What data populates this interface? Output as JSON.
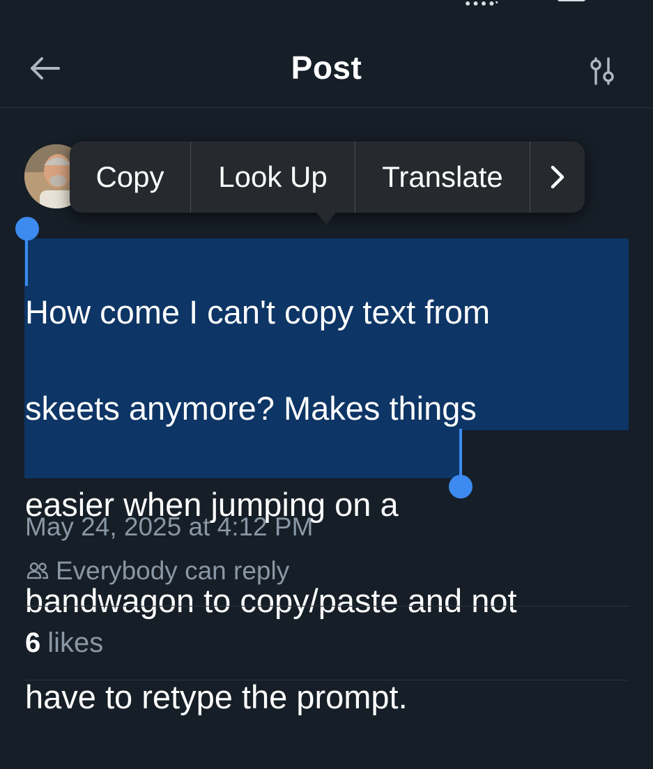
{
  "header": {
    "title": "Post",
    "back_icon": "arrow-left-icon",
    "settings_icon": "sliders-icon"
  },
  "context_menu": {
    "items": [
      "Copy",
      "Look Up",
      "Translate"
    ],
    "more_icon": "chevron-right-icon"
  },
  "post": {
    "text_lines": [
      "How come I can't copy text from",
      "skeets anymore?  Makes things",
      "easier when jumping on a",
      "bandwagon to copy/paste and not",
      "have to retype the prompt."
    ],
    "timestamp": "May 24, 2025 at 4:12 PM",
    "reply_setting": "Everybody can reply",
    "likes_count": "6",
    "likes_label": "likes"
  },
  "colors": {
    "background": "#161e27",
    "selection": "#0d3565",
    "selection_handle": "#3d8bf0",
    "menu_background": "#262a2f",
    "muted_text": "#8a97a5"
  }
}
